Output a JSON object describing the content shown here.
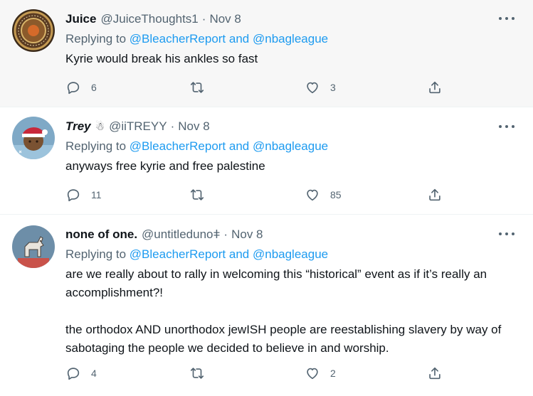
{
  "tweets": [
    {
      "name": "Juice",
      "handle": "@JuiceThoughts1",
      "sep": "·",
      "date": "Nov 8",
      "emoji": "",
      "replying_prefix": "Replying to ",
      "mention1": "@BleacherReport",
      "and": " and ",
      "mention2": "@nbagleague",
      "text": [
        "Kyrie would break his ankles so fast"
      ],
      "replies": "6",
      "retweets": "",
      "likes": "3",
      "avatar_colors": [
        "#5a3b22",
        "#c49a52"
      ]
    },
    {
      "name": "Trey",
      "handle": "@iiTREYY",
      "sep": "·",
      "date": "Nov 8",
      "emoji": "☃",
      "replying_prefix": "Replying to ",
      "mention1": "@BleacherReport",
      "and": " and ",
      "mention2": "@nbagleague",
      "text": [
        "anyways free kyrie and free palestine"
      ],
      "replies": "11",
      "retweets": "",
      "likes": "85",
      "avatar_colors": [
        "#7fa9c6",
        "#c8283a"
      ]
    },
    {
      "name": "none of one.",
      "handle": "@untitledunoǂ",
      "sep": "·",
      "date": "Nov 8",
      "emoji": "",
      "replying_prefix": "Replying to ",
      "mention1": "@BleacherReport",
      "and": " and ",
      "mention2": "@nbagleague",
      "text": [
        "are we really about to rally in welcoming this “historical” event as if it’s really an accomplishment?!",
        "the orthodox AND unorthodox jewISH people are reestablishing slavery by way of sabotaging the people we decided to believe in and worship."
      ],
      "replies": "4",
      "retweets": "",
      "likes": "2",
      "avatar_colors": [
        "#6d8ea8",
        "#e9e4dc"
      ]
    }
  ],
  "icons": {
    "reply": "reply-icon",
    "retweet": "retweet-icon",
    "like": "heart-icon",
    "share": "share-icon",
    "more": "more-icon"
  },
  "colors": {
    "link": "#1d9bf0",
    "muted": "#536471",
    "text": "#0f1419",
    "highlight_bg": "#f7f7f7"
  }
}
